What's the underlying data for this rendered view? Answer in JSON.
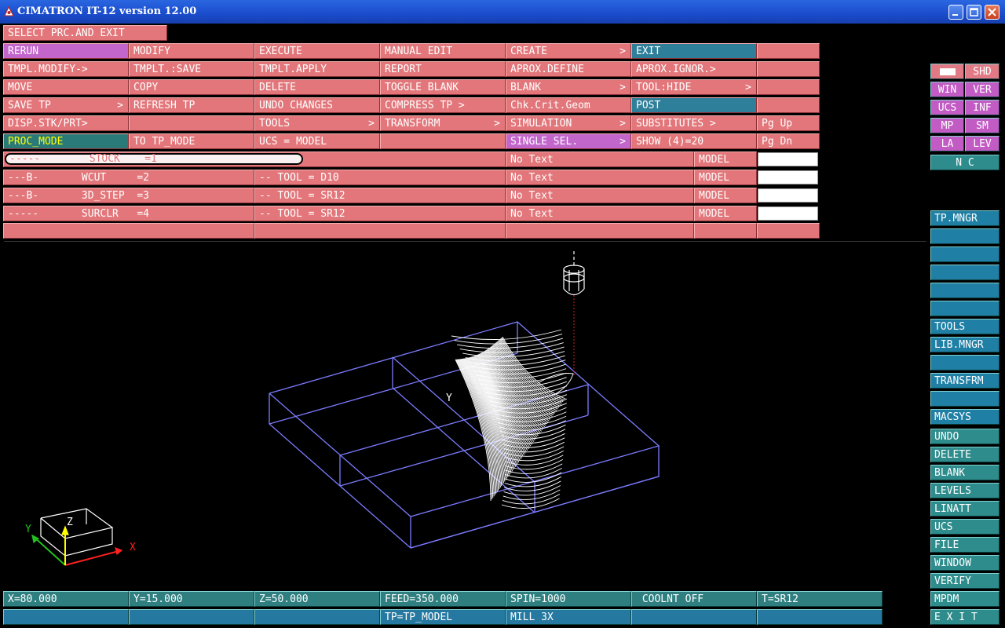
{
  "window": {
    "title": "CIMATRON IT-12 version 12.00"
  },
  "prompt": "SELECT PRC.AND EXIT",
  "menu": {
    "rows": [
      [
        {
          "label": "RERUN",
          "style": "sel"
        },
        {
          "label": "MODIFY"
        },
        {
          "label": "EXECUTE"
        },
        {
          "label": "MANUAL EDIT"
        },
        {
          "label": "CREATE",
          "arrow": ">"
        },
        {
          "label": "EXIT",
          "style": "blue"
        },
        {
          "label": ""
        }
      ],
      [
        {
          "label": "TMPL.MODIFY->"
        },
        {
          "label": "TMPLT.:SAVE"
        },
        {
          "label": "TMPLT.APPLY"
        },
        {
          "label": "REPORT"
        },
        {
          "label": "APROX.DEFINE"
        },
        {
          "label": "APROX.IGNOR.>"
        },
        {
          "label": ""
        }
      ],
      [
        {
          "label": "MOVE"
        },
        {
          "label": "COPY"
        },
        {
          "label": "DELETE"
        },
        {
          "label": "TOGGLE BLANK"
        },
        {
          "label": "BLANK",
          "arrow": ">"
        },
        {
          "label": "TOOL:HIDE",
          "arrow": ">"
        },
        {
          "label": ""
        }
      ],
      [
        {
          "label": "SAVE TP",
          "arrow": ">"
        },
        {
          "label": "REFRESH TP"
        },
        {
          "label": "UNDO CHANGES"
        },
        {
          "label": "COMPRESS TP >"
        },
        {
          "label": "Chk.Crit.Geom"
        },
        {
          "label": "POST",
          "style": "blue"
        },
        {
          "label": ""
        }
      ],
      [
        {
          "label": "DISP.STK/PRT>"
        },
        {
          "label": ""
        },
        {
          "label": "TOOLS",
          "arrow": ">"
        },
        {
          "label": "TRANSFORM",
          "arrow": ">"
        },
        {
          "label": "SIMULATION",
          "arrow": ">"
        },
        {
          "label": "SUBSTITUTES >"
        },
        {
          "label": "Pg Up"
        }
      ],
      [
        {
          "label": "PROC_MODE",
          "style": "proc"
        },
        {
          "label": "TO TP_MODE"
        },
        {
          "label": "UCS = MODEL"
        },
        {
          "label": ""
        },
        {
          "label": "SINGLE SEL.",
          "arrow": ">",
          "style": "sel"
        },
        {
          "label": "SHOW (4)=20"
        },
        {
          "label": "Pg Dn"
        }
      ]
    ]
  },
  "procedures": [
    {
      "name": "-----        STOCK    =1",
      "tool": "",
      "text": "No Text",
      "model": "MODEL"
    },
    {
      "name": "---B-       WCUT     =2",
      "tool": "-- TOOL = D10",
      "text": "No Text",
      "model": "MODEL"
    },
    {
      "name": "---B-       3D_STEP  =3",
      "tool": "-- TOOL = SR12",
      "text": "No Text",
      "model": "MODEL"
    },
    {
      "name": "-----       SURCLR   =4",
      "tool": "-- TOOL = SR12",
      "text": "No Text",
      "model": "MODEL"
    }
  ],
  "sidebar": {
    "top": [
      [
        {
          "label": "",
          "style": "pinkc",
          "icon": "color-swatch-icon"
        },
        {
          "label": "SHD",
          "style": "pinkc"
        }
      ],
      [
        {
          "label": "WIN",
          "style": "mag"
        },
        {
          "label": "VER",
          "style": "mag"
        }
      ],
      [
        {
          "label": "UCS",
          "style": "mag"
        },
        {
          "label": "INF",
          "style": "mag"
        }
      ],
      [
        {
          "label": "MP",
          "style": "mag"
        },
        {
          "label": "SM",
          "style": "mag"
        }
      ],
      [
        {
          "label": "LA",
          "style": "mag"
        },
        {
          "label": "LEV",
          "style": "mag"
        }
      ]
    ],
    "nc": "N C",
    "mid": [
      "TP.MNGR",
      "",
      "",
      "",
      "",
      "",
      "TOOLS",
      "LIB.MNGR",
      "",
      "TRANSFRM",
      "",
      "MACSYS"
    ],
    "bottom": [
      "UNDO",
      "DELETE",
      "BLANK",
      "LEVELS",
      "LINATT",
      "UCS",
      "FILE",
      "WINDOW",
      "VERIFY",
      "MPDM",
      "E X I T"
    ]
  },
  "status": {
    "row1": [
      "X=80.000",
      "Y=15.000",
      "Z=50.000",
      "FEED=350.000",
      "SPIN=1000",
      " COOLNT OFF",
      "T=SR12"
    ],
    "row2": [
      "",
      "",
      "",
      "TP=TP_MODEL",
      "MILL 3X",
      "",
      ""
    ]
  },
  "viewport": {
    "axis_labels": {
      "x": "X",
      "y": "Y",
      "z": "Z"
    },
    "model_axis_label": "Y",
    "colors": {
      "stock": "#7b7bff",
      "toolpath": "#ffffff",
      "tool": "#ffffff",
      "axis_x": "#ff2020",
      "axis_y": "#20c020",
      "axis_z": "#ffff00"
    }
  }
}
